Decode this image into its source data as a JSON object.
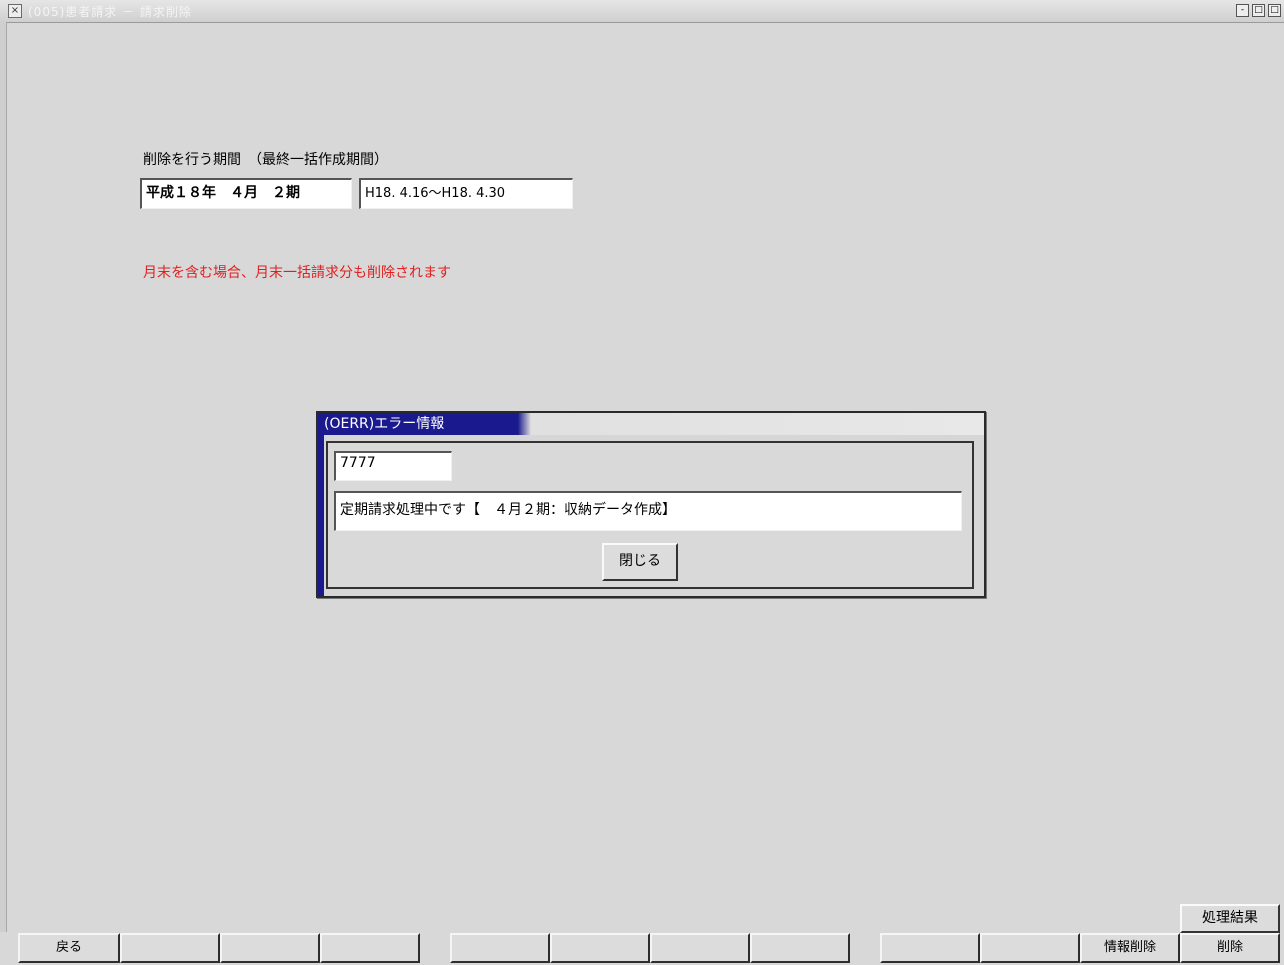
{
  "window": {
    "title": "(005)患者請求 － 請求削除",
    "controls": [
      "minimize",
      "maximize",
      "close"
    ]
  },
  "form": {
    "period_label": "削除を行う期間　（最終一括作成期間）",
    "period_value": "平成１８年　４月　２期",
    "period_range": "H18. 4.16～H18. 4.30",
    "warning": "月末を含む場合、月末一括請求分も削除されます"
  },
  "dialog": {
    "title": "(OERR)エラー情報",
    "error_code": "7777",
    "message": "定期請求処理中です【　４月２期：収納データ作成】",
    "close_label": "閉じる"
  },
  "footer": {
    "keys": [
      "戻る",
      "",
      "",
      "",
      "",
      "",
      "",
      "",
      "",
      "",
      "",
      "",
      "情報削除",
      "削除"
    ],
    "extra_label": "処理結果"
  },
  "colors": {
    "warning": "#e02020",
    "dialog_title_bg": "#1a1a8e",
    "background": "#d8d8d8"
  }
}
